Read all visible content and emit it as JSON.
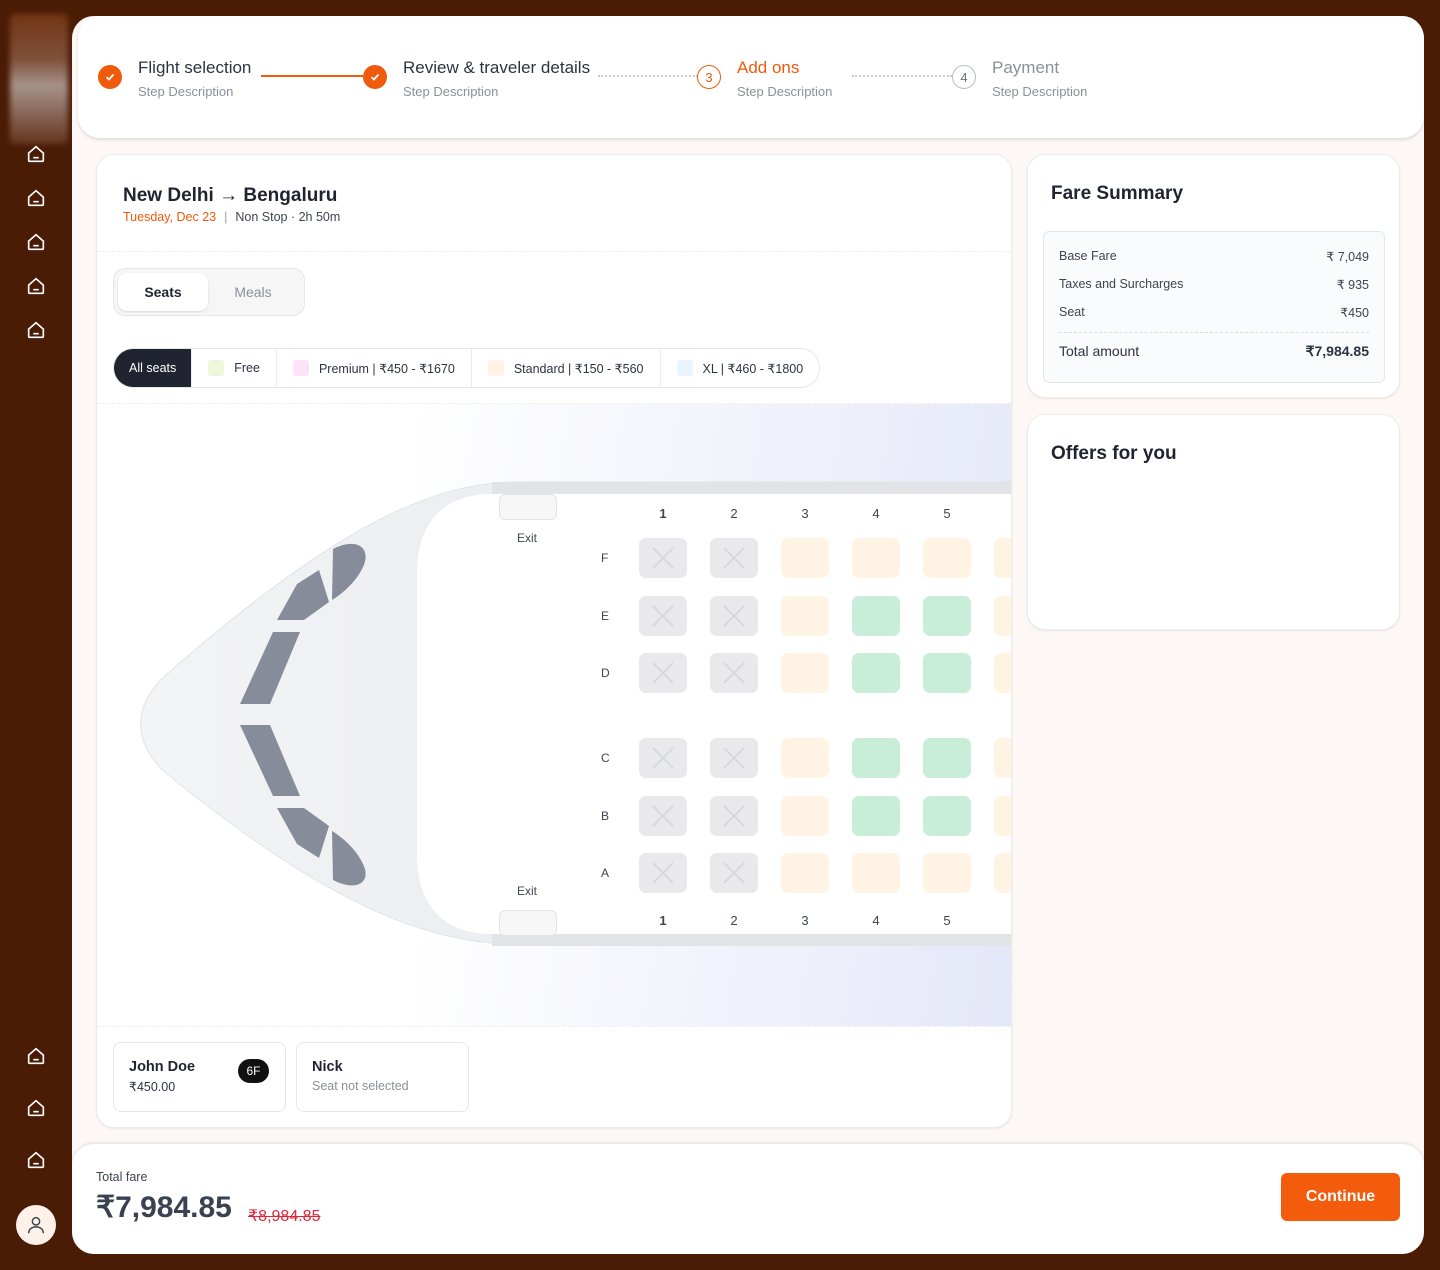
{
  "steps": [
    {
      "title": "Flight selection",
      "desc": "Step Description",
      "state": "done"
    },
    {
      "title": "Review & traveler details",
      "desc": "Step Description",
      "state": "done"
    },
    {
      "title": "Add ons",
      "desc": "Step Description",
      "state": "active",
      "number": "3"
    },
    {
      "title": "Payment",
      "desc": "Step Description",
      "state": "pending",
      "number": "4"
    }
  ],
  "flight": {
    "origin": "New Delhi",
    "arrow": "→",
    "destination": "Bengaluru",
    "date": "Tuesday, Dec 23",
    "separator": "|",
    "info": "Non Stop · 2h 50m"
  },
  "tabs": [
    "Seats",
    "Meals"
  ],
  "filters": [
    {
      "label": "All seats",
      "color": ""
    },
    {
      "label": "Free",
      "color": "#eef7d9"
    },
    {
      "label": "Premium | ₹450 - ₹1670",
      "color": "#fde3f8"
    },
    {
      "label": "Standard | ₹150 - ₹560",
      "color": "#fff4e4"
    },
    {
      "label": "XL | ₹460 - ₹1800",
      "color": "#e7f6fd"
    }
  ],
  "seatmap": {
    "columns": [
      "1",
      "2",
      "3",
      "4",
      "5"
    ],
    "rows": [
      "F",
      "E",
      "D",
      "C",
      "B",
      "A"
    ],
    "exit_label": "Exit",
    "seat_types": {
      "F": [
        "occupied",
        "occupied",
        "standard",
        "standard",
        "standard",
        "standard"
      ],
      "E": [
        "occupied",
        "occupied",
        "standard",
        "free",
        "free",
        "standard"
      ],
      "D": [
        "occupied",
        "occupied",
        "standard",
        "free",
        "free",
        "standard"
      ],
      "C": [
        "occupied",
        "occupied",
        "standard",
        "free",
        "free",
        "standard"
      ],
      "B": [
        "occupied",
        "occupied",
        "standard",
        "free",
        "free",
        "standard"
      ],
      "A": [
        "occupied",
        "occupied",
        "standard",
        "standard",
        "standard",
        "standard"
      ]
    }
  },
  "travelers": [
    {
      "name": "John Doe",
      "sub": "₹450.00",
      "seat": "6F"
    },
    {
      "name": "Nick",
      "sub": "Seat not selected",
      "seat": ""
    }
  ],
  "fare_summary": {
    "title": "Fare Summary",
    "rows": [
      {
        "label": "Base Fare",
        "value": "₹ 7,049"
      },
      {
        "label": "Taxes and Surcharges",
        "value": "₹ 935"
      },
      {
        "label": "Seat",
        "value": "₹450"
      }
    ],
    "total_label": "Total amount",
    "total_value": "₹7,984.85"
  },
  "offers": {
    "title": "Offers for you"
  },
  "footer": {
    "total_label": "Total fare",
    "total": "₹7,984.85",
    "original": "₹8,984.85",
    "continue_label": "Continue"
  },
  "colors": {
    "accent": "#f25c0c",
    "free_seat": "#c8eed9",
    "standard_seat": "#fff4e4",
    "occupied_seat": "#e9e9ec"
  }
}
